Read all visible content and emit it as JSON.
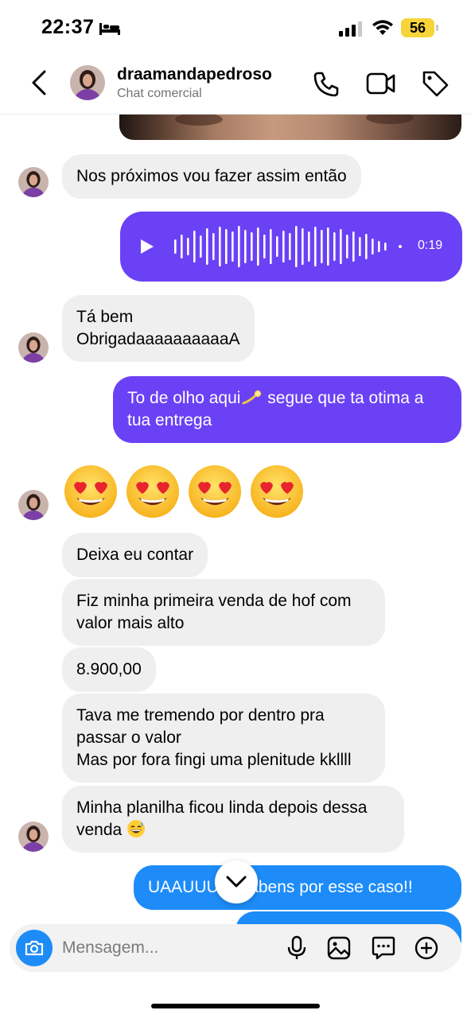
{
  "status_bar": {
    "time": "22:37",
    "battery": "56"
  },
  "header": {
    "name": "draamandapedroso",
    "subtitle": "Chat comercial"
  },
  "messages": {
    "m1": "Nos próximos vou fazer assim então",
    "voice_duration": "0:19",
    "m2_line1": "Tá bem",
    "m2_line2": "ObrigadaaaaaaaaaaA",
    "m3_a": "To de olho aqui",
    "m3_b": " segue que ta otima a tua entrega",
    "m4_emojis": [
      "😍",
      "😍",
      "😍",
      "😍"
    ],
    "m5": "Deixa eu contar",
    "m6": "Fiz minha primeira venda de hof com valor mais alto",
    "m7": "8.900,00",
    "m8_line1": "Tava me tremendo por dentro pra passar o valor",
    "m8_line2": "Mas por fora fingi uma plenitude kkllll",
    "m9": "Minha planilha ficou linda depois dessa venda",
    "m10": "UAAUUU Parabens por esse caso!!"
  },
  "composer": {
    "placeholder": "Mensagem..."
  },
  "icons": {
    "back": "chevron-left-icon",
    "phone": "phone-icon",
    "video": "video-camera-icon",
    "tag": "tag-icon",
    "camera": "camera-icon",
    "mic": "microphone-icon",
    "gallery": "image-icon",
    "sticker": "chat-sticker-icon",
    "plus": "plus-circle-icon",
    "scroll": "chevron-down-icon",
    "play": "play-icon"
  },
  "colors": {
    "outgoing_purple": "#6b41f5",
    "outgoing_blue": "#1d8cf8",
    "incoming_gray": "#efefef",
    "battery_yellow": "#f7d53a"
  }
}
